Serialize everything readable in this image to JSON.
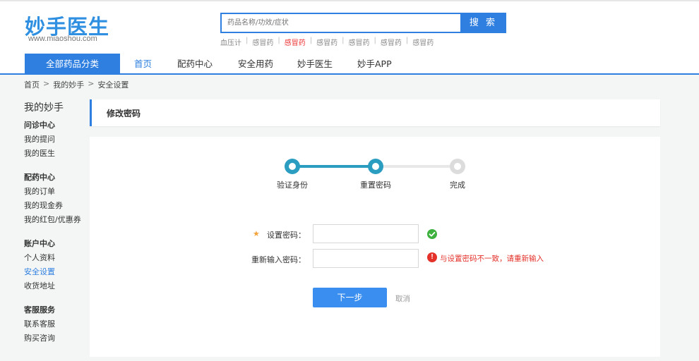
{
  "site": {
    "logo_text": "妙手医生",
    "logo_url": "www.miaoshou.com"
  },
  "search": {
    "placeholder": "药品名称/功效/症状",
    "button_label": "搜 索",
    "hot_words": [
      {
        "label": "血压计",
        "highlight": false
      },
      {
        "label": "感冒药",
        "highlight": false
      },
      {
        "label": "感冒药",
        "highlight": true
      },
      {
        "label": "感冒药",
        "highlight": false
      },
      {
        "label": "感冒药",
        "highlight": false
      },
      {
        "label": "感冒药",
        "highlight": false
      },
      {
        "label": "感冒药",
        "highlight": false
      }
    ]
  },
  "nav": {
    "all_categories": "全部药品分类",
    "items": [
      {
        "label": "首页",
        "active": true
      },
      {
        "label": "配药中心",
        "active": false
      },
      {
        "label": "安全用药",
        "active": false
      },
      {
        "label": "妙手医生",
        "active": false
      },
      {
        "label": "妙手APP",
        "active": false
      }
    ]
  },
  "breadcrumb": [
    "首页",
    "我的妙手",
    "安全设置"
  ],
  "sidebar": {
    "title": "我的妙手",
    "groups": [
      {
        "title": "问诊中心",
        "items": [
          {
            "label": "我的提问",
            "active": false
          },
          {
            "label": "我的医生",
            "active": false
          }
        ]
      },
      {
        "title": "配药中心",
        "items": [
          {
            "label": "我的订单",
            "active": false
          },
          {
            "label": "我的现金券",
            "active": false
          },
          {
            "label": "我的红包/优惠券",
            "active": false
          }
        ]
      },
      {
        "title": "账户中心",
        "items": [
          {
            "label": "个人资料",
            "active": false
          },
          {
            "label": "安全设置",
            "active": true
          },
          {
            "label": "收货地址",
            "active": false
          }
        ]
      },
      {
        "title": "客服服务",
        "items": [
          {
            "label": "联系客服",
            "active": false
          },
          {
            "label": "购买咨询",
            "active": false
          }
        ]
      }
    ]
  },
  "panel": {
    "title": "修改密码"
  },
  "steps": [
    {
      "label": "验证身份",
      "status": "done"
    },
    {
      "label": "重置密码",
      "status": "current"
    },
    {
      "label": "完成",
      "status": "pending"
    }
  ],
  "form": {
    "required_mark": "★",
    "password_label": "设置密码：",
    "password_value": "",
    "confirm_label": "重新输入密码：",
    "confirm_value": "",
    "error_message": "与设置密码不一致，请重新输入",
    "error_icon": "!",
    "next_button": "下一步",
    "cancel_link": "取消"
  },
  "colors": {
    "brand_blue": "#2f7fe0",
    "step_teal": "#2a9dc0",
    "error_red": "#e4312a",
    "ok_green": "#3db13d",
    "star_orange": "#f2a33a"
  }
}
